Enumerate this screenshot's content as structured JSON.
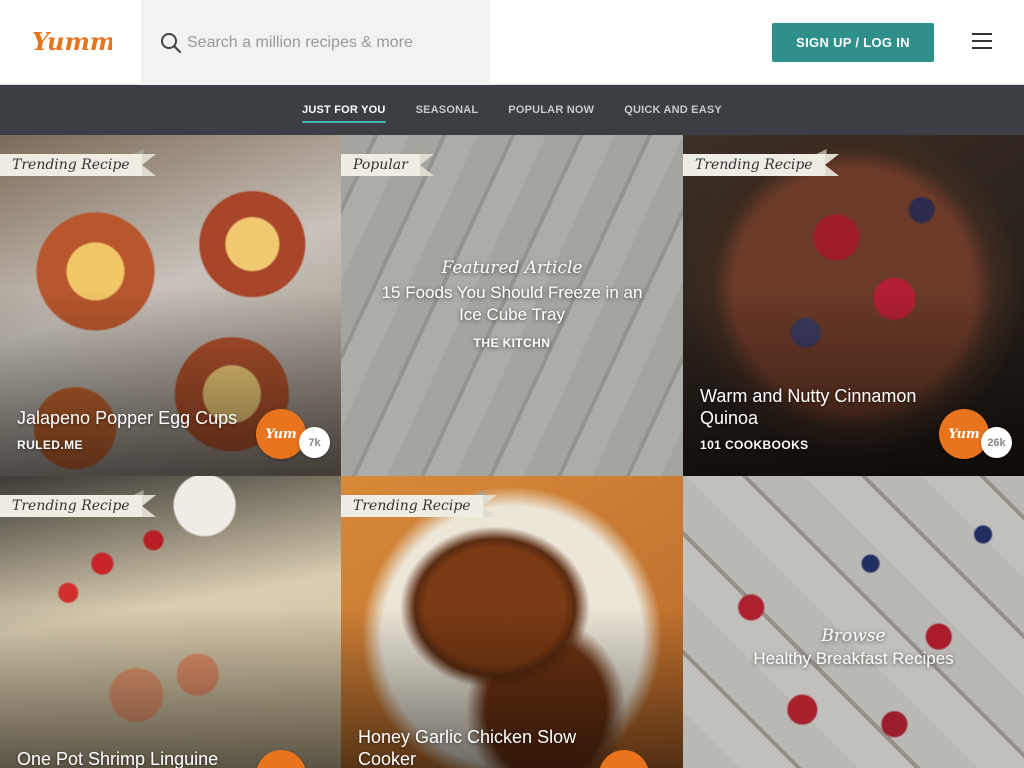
{
  "brand": {
    "logo_text": "Yummly",
    "accent": "#e8741d",
    "teal": "#2f8f8a"
  },
  "search": {
    "placeholder": "Search a million recipes & more"
  },
  "header": {
    "signup_label": "SIGN UP / LOG IN"
  },
  "nav": {
    "items": [
      {
        "label": "JUST FOR YOU",
        "active": true
      },
      {
        "label": "SEASONAL",
        "active": false
      },
      {
        "label": "POPULAR NOW",
        "active": false
      },
      {
        "label": "QUICK AND EASY",
        "active": false
      }
    ]
  },
  "tiles": [
    {
      "ribbon": "Trending Recipe",
      "title": "Jalapeno Popper Egg Cups",
      "source": "RULED.ME",
      "yum": "Yum",
      "count": "7k"
    },
    {
      "ribbon": "Popular",
      "kicker": "Featured Article",
      "title": "15 Foods You Should Freeze in an Ice Cube Tray",
      "source": "THE KITCHN"
    },
    {
      "ribbon": "Trending Recipe",
      "title": "Warm and Nutty Cinnamon Quinoa",
      "source": "101 COOKBOOKS",
      "yum": "Yum",
      "count": "26k"
    },
    {
      "ribbon": "Trending Recipe",
      "title": "One Pot Shrimp Linguine",
      "yum": "Yum"
    },
    {
      "ribbon": "Trending Recipe",
      "title": "Honey Garlic Chicken Slow Cooker",
      "yum": "Yum"
    },
    {
      "kicker": "Browse",
      "title": "Healthy Breakfast Recipes"
    }
  ]
}
